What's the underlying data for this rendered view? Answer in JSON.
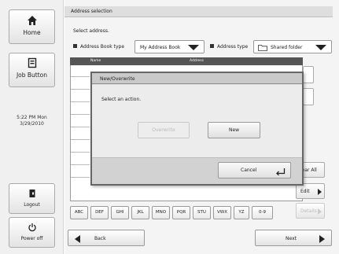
{
  "sidebar": {
    "home_label": "Home",
    "job_label": "Job Button",
    "clock_time": "5:22 PM Mon",
    "clock_date": "3/29/2010",
    "logout_label": "Logout",
    "power_label": "Power off"
  },
  "header": {
    "title": "Address selection"
  },
  "main": {
    "prompt": "Select address.",
    "address_book_type_label": "Address Book type",
    "address_book_type_value": "My Address Book",
    "address_type_label": "Address type",
    "address_type_value": "Shared folder"
  },
  "list": {
    "columns": [
      "Name",
      "Address"
    ]
  },
  "actions": {
    "clear_all": "lear All",
    "edit": "Edit",
    "details": "Details"
  },
  "alpha_index": [
    "ABC",
    "DEF",
    "GHI",
    "JKL",
    "MNO",
    "PQR",
    "STU",
    "VWX",
    "YZ",
    "0-9"
  ],
  "nav": {
    "back": "Back",
    "next": "Next"
  },
  "dialog": {
    "title": "New/Overwrite",
    "message": "Select an action.",
    "overwrite": "Overwrite",
    "new": "New",
    "cancel": "Cancel"
  },
  "icons": [
    "home-icon",
    "job-icon",
    "logout-icon",
    "power-icon",
    "folder-icon",
    "enter-icon"
  ]
}
